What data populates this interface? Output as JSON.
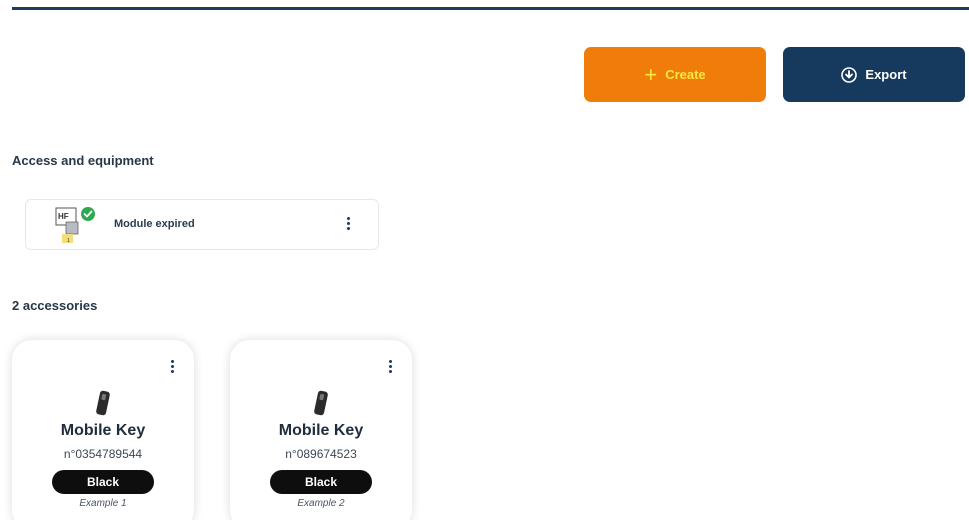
{
  "toolbar": {
    "create_label": "Create",
    "export_label": "Export",
    "plus_icon": "+",
    "colors": {
      "create_bg": "#f07d0a",
      "create_text": "#fde740",
      "export_bg": "#16395e"
    }
  },
  "access_section": {
    "title": "Access and equipment",
    "module": {
      "label": "Module expired",
      "icon": "hf-module-icon",
      "badge_icon": "check-circle-icon",
      "icon_text": "HF"
    }
  },
  "accessories_section": {
    "title": "2 accessories",
    "items": [
      {
        "name": "Mobile Key",
        "serial": "n°0354789544",
        "color": "Black",
        "note": "Example 1"
      },
      {
        "name": "Mobile Key",
        "serial": "n°089674523",
        "color": "Black",
        "note": "Example 2"
      }
    ]
  }
}
